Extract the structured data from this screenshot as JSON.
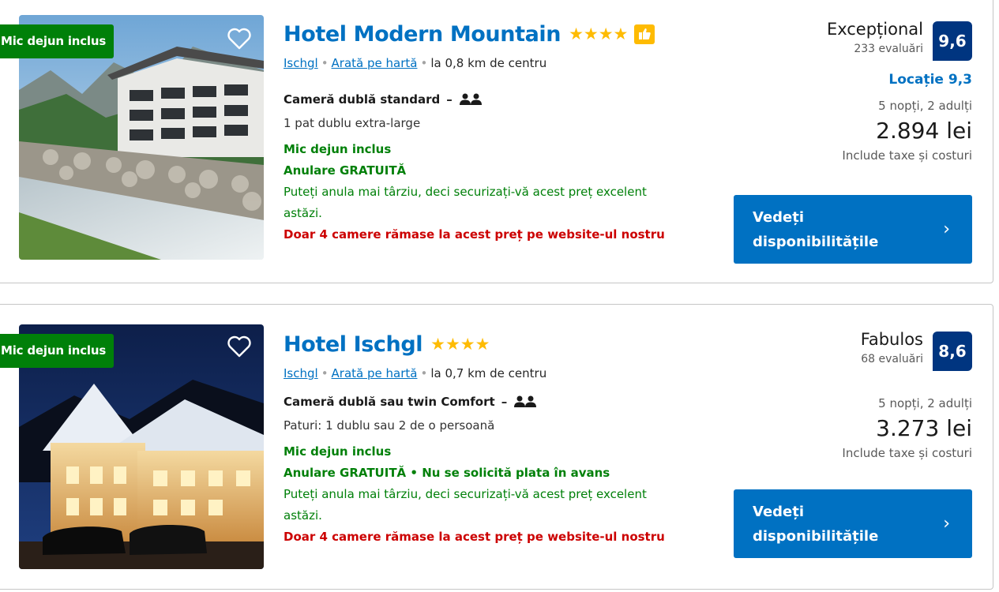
{
  "hotels": [
    {
      "badge": "Mic dejun inclus",
      "name": "Hotel Modern Mountain",
      "stars": "★★★★",
      "star_count": 4,
      "has_thumb_badge": true,
      "town": "Ischgl",
      "map_link": "Arată pe hartă",
      "distance": "la 0,8 km de centru",
      "room": "Cameră dublă standard",
      "bed": "1 pat dublu extra-large",
      "breakfast": "Mic dejun inclus",
      "cancel": "Anulare GRATUITĂ",
      "cancel_note": "Puteți anula mai târziu, deci securizați-vă acest preț excelent astăzi.",
      "scarcity": "Doar 4 camere rămase la acest preț pe website-ul nostru",
      "score_word": "Excepțional",
      "reviews": "233 evaluări",
      "score": "9,6",
      "location_score": "Locație 9,3",
      "nights": "5 nopți, 2 adulți",
      "price": "2.894 lei",
      "taxes": "Include taxe și costuri",
      "cta": "Vedeți disponibilitățile"
    },
    {
      "badge": "Mic dejun inclus",
      "name": "Hotel Ischgl",
      "stars": "★★★★",
      "star_count": 4,
      "has_thumb_badge": false,
      "town": "Ischgl",
      "map_link": "Arată pe hartă",
      "distance": "la 0,7 km de centru",
      "room": "Cameră dublă sau twin Comfort",
      "bed": "Paturi: 1 dublu sau 2 de o persoană",
      "breakfast": "Mic dejun inclus",
      "cancel": "Anulare GRATUITĂ • Nu se solicită plata în avans",
      "cancel_note": "Puteți anula mai târziu, deci securizați-vă acest preț excelent astăzi.",
      "scarcity": "Doar 4 camere rămase la acest preț pe website-ul nostru",
      "score_word": "Fabulos",
      "reviews": "68 evaluări",
      "score": "8,6",
      "nights": "5 nopți, 2 adulți",
      "price": "3.273 lei",
      "taxes": "Include taxe și costuri",
      "cta": "Vedeți disponibilitățile"
    }
  ],
  "colors": {
    "link_blue": "#0071c2",
    "score_navy": "#003580",
    "green": "#008009",
    "red": "#cc0000",
    "star_yellow": "#febb02"
  },
  "icons": {
    "favorite": "heart-outline-icon",
    "occupancy": "two-persons-icon",
    "thumb": "thumbs-up-icon",
    "chevron": "chevron-right-icon"
  }
}
